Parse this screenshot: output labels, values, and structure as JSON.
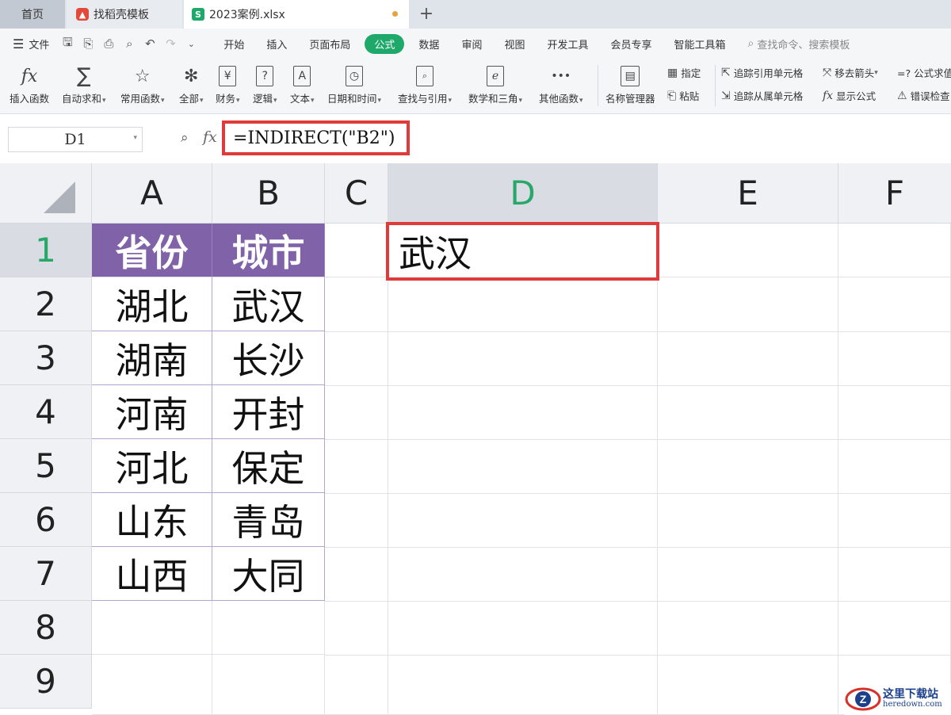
{
  "tabs": [
    {
      "label": "首页"
    },
    {
      "label": "找稻壳模板",
      "icon": "daoke-icon"
    },
    {
      "label": "2023案例.xlsx",
      "icon": "spreadsheet-s-icon",
      "unsaved": true
    }
  ],
  "menu": {
    "file_label": "文件",
    "items": [
      "开始",
      "插入",
      "页面布局",
      "公式",
      "数据",
      "审阅",
      "视图",
      "开发工具",
      "会员专享",
      "智能工具箱"
    ],
    "active": "公式",
    "search_placeholder": "查找命令、搜索模板"
  },
  "ribbon": {
    "insert_function": "插入函数",
    "autosum": "自动求和",
    "common_functions": "常用函数",
    "all": "全部",
    "finance": "财务",
    "logic": "逻辑",
    "text": "文本",
    "datetime": "日期和时间",
    "lookup": "查找与引用",
    "math": "数学和三角",
    "other": "其他函数",
    "name_manager": "名称管理器",
    "specify": "指定",
    "paste": "粘贴",
    "trace_precedents": "追踪引用单元格",
    "trace_dependents": "追踪从属单元格",
    "remove_arrows": "移去箭头",
    "show_formulas": "显示公式",
    "formula_eval": "=? 公式求值",
    "error_check": "错误检查",
    "fx_glyph": "fx",
    "all_glyph": "✻",
    "finance_glyph": "¥",
    "logic_glyph": "?",
    "text_glyph": "A",
    "lookup_glyph": "🔍",
    "math_glyph": "e",
    "other_glyph": "•••"
  },
  "formula_bar": {
    "cell_ref": "D1",
    "fx_label": "fx",
    "formula": "=INDIRECT(\"B2\")"
  },
  "sheet": {
    "columns": [
      "A",
      "B",
      "C",
      "D",
      "E",
      "F"
    ],
    "selected_column": "D",
    "rows": [
      "1",
      "2",
      "3",
      "4",
      "5",
      "6",
      "7",
      "8",
      "9"
    ],
    "selected_row": "1",
    "header_color": "#8062a8",
    "headers": [
      "省份",
      "城市"
    ],
    "data": [
      [
        "湖北",
        "武汉"
      ],
      [
        "湖南",
        "长沙"
      ],
      [
        "河南",
        "开封"
      ],
      [
        "河北",
        "保定"
      ],
      [
        "山东",
        "青岛"
      ],
      [
        "山西",
        "大同"
      ]
    ],
    "d1_value": "武汉"
  },
  "watermark": {
    "cn": "这里下载站",
    "en": "heredown.com"
  }
}
